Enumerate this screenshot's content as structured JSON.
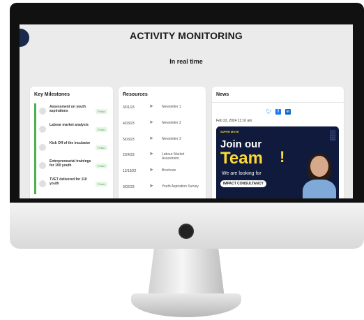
{
  "page": {
    "title": "ACTIVITY MONITORING",
    "subtitle": "In real time"
  },
  "milestones": {
    "title": "Key Milestones",
    "items": [
      {
        "label": "Assessment on youth aspirations",
        "status": "Finish"
      },
      {
        "label": "Labour market analysis",
        "status": "Finish"
      },
      {
        "label": "Kick Off of the incubator",
        "status": "Finish"
      },
      {
        "label": "Entrepreneurial trainings for 100 youth",
        "status": "Finish"
      },
      {
        "label": "TVET delivered for 110 youth",
        "status": "Finish"
      }
    ]
  },
  "resources": {
    "title": "Resources",
    "items": [
      {
        "date": "3/01/23",
        "name": "Newsletter 1"
      },
      {
        "date": "4/03/23",
        "name": "Newsletter 2"
      },
      {
        "date": "5/03/23",
        "name": "Newsletter 3"
      },
      {
        "date": "2/24/23",
        "name": "Labour Market Assesment"
      },
      {
        "date": "12/19/22",
        "name": "Brochure"
      },
      {
        "date": "3/02/23",
        "name": "Youth Aspiration Survey"
      }
    ]
  },
  "news": {
    "title": "News",
    "date": "Feb 22, 2024 11:16 am",
    "promo": {
      "brand": "SUPER MOVE",
      "join": "Join our",
      "team": "Team",
      "exclaim": "!",
      "looking": "We are looking for",
      "company": "IMPACT CONSULTANCY"
    }
  },
  "icons": {
    "twitter": "twitter-icon",
    "facebook": "facebook-icon",
    "linkedin": "linkedin-icon",
    "send": "paper-plane-icon"
  },
  "colors": {
    "accent_green": "#4caf50",
    "twitter_blue": "#1da1f2",
    "facebook_blue": "#1877f2",
    "linkedin_blue": "#0a66c2",
    "promo_navy": "#0f1a3d",
    "promo_yellow": "#fdd835"
  }
}
